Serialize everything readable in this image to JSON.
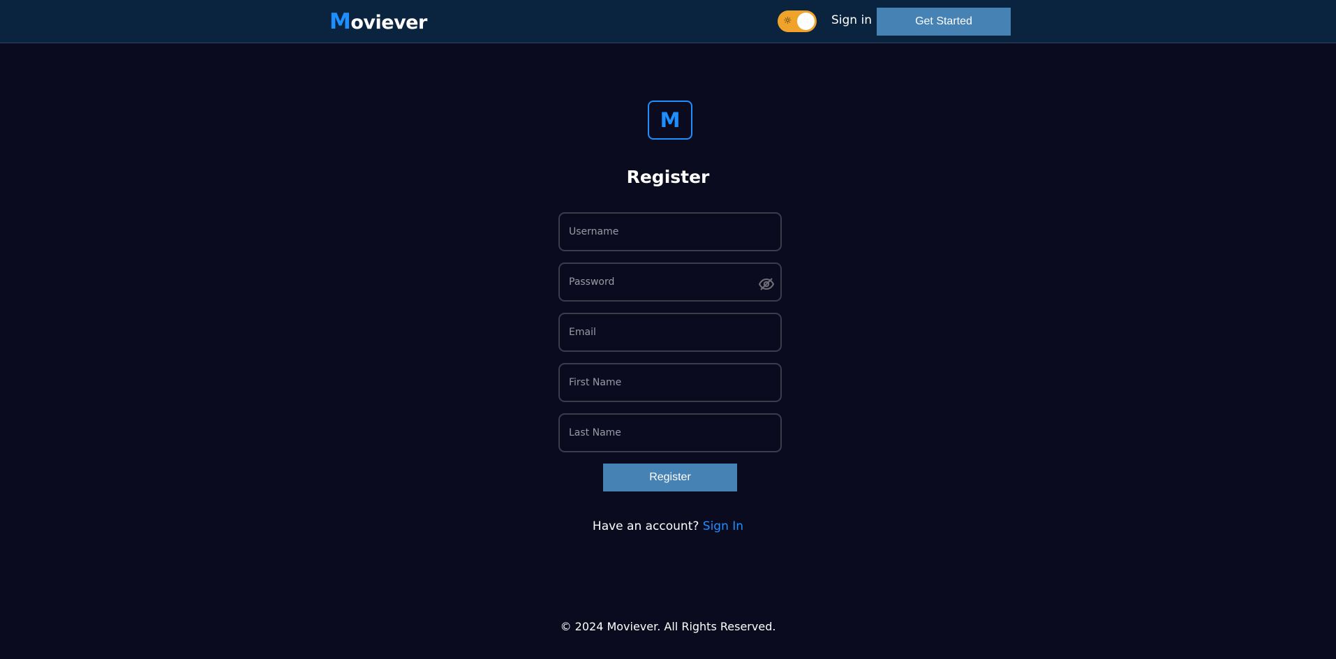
{
  "header": {
    "logo_initial": "M",
    "logo_rest": "oviever",
    "theme_toggle": {
      "state": "on",
      "icon": "sun-icon",
      "color": "#f0a32a"
    },
    "signin_label": "Sign in",
    "get_started_label": "Get Started"
  },
  "form": {
    "badge_letter": "M",
    "title": "Register",
    "fields": {
      "username": {
        "placeholder": "Username",
        "value": ""
      },
      "password": {
        "placeholder": "Password",
        "value": "",
        "toggle_icon": "eye-off-icon"
      },
      "email": {
        "placeholder": "Email",
        "value": ""
      },
      "first_name": {
        "placeholder": "First Name",
        "value": ""
      },
      "last_name": {
        "placeholder": "Last Name",
        "value": ""
      }
    },
    "submit_label": "Register",
    "account_prompt": "Have an account?",
    "signin_link_label": "Sign In"
  },
  "footer": {
    "copyright": "© 2024 Moviever. All Rights Reserved."
  },
  "colors": {
    "background": "#0b0b1f",
    "header_bg": "#0a2440",
    "accent_blue": "#1e8fff",
    "button_bg": "#4682b4",
    "toggle_bg": "#f0a32a",
    "input_border": "#3b3b4a"
  }
}
